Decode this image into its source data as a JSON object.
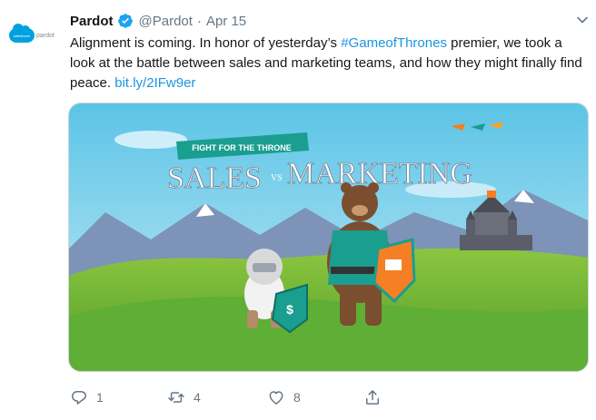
{
  "author": {
    "name": "Pardot",
    "handle": "@Pardot",
    "date": "Apr 15",
    "avatar_brand": "pardot",
    "avatar_cloud": "salesforce"
  },
  "tweet": {
    "text_before": "Alignment is coming. In honor of yesterday’s ",
    "hashtag": "#GameofThrones",
    "text_after": " premier, we took a look at the battle between sales and marketing teams, and how they might finally find peace. ",
    "link": "bit.ly/2IFw9er"
  },
  "media": {
    "banner_text": "FIGHT FOR THE THRONE",
    "title_left": "SALES",
    "title_vs": "VS",
    "title_right": "MARKETING"
  },
  "actions": {
    "reply_count": "1",
    "retweet_count": "4",
    "like_count": "8"
  },
  "colors": {
    "link": "#1b95e0",
    "muted": "#657786",
    "verified": "#1da1f2"
  },
  "icons": [
    "verified-badge-icon",
    "chevron-down-icon",
    "reply-icon",
    "retweet-icon",
    "like-icon",
    "share-icon"
  ]
}
